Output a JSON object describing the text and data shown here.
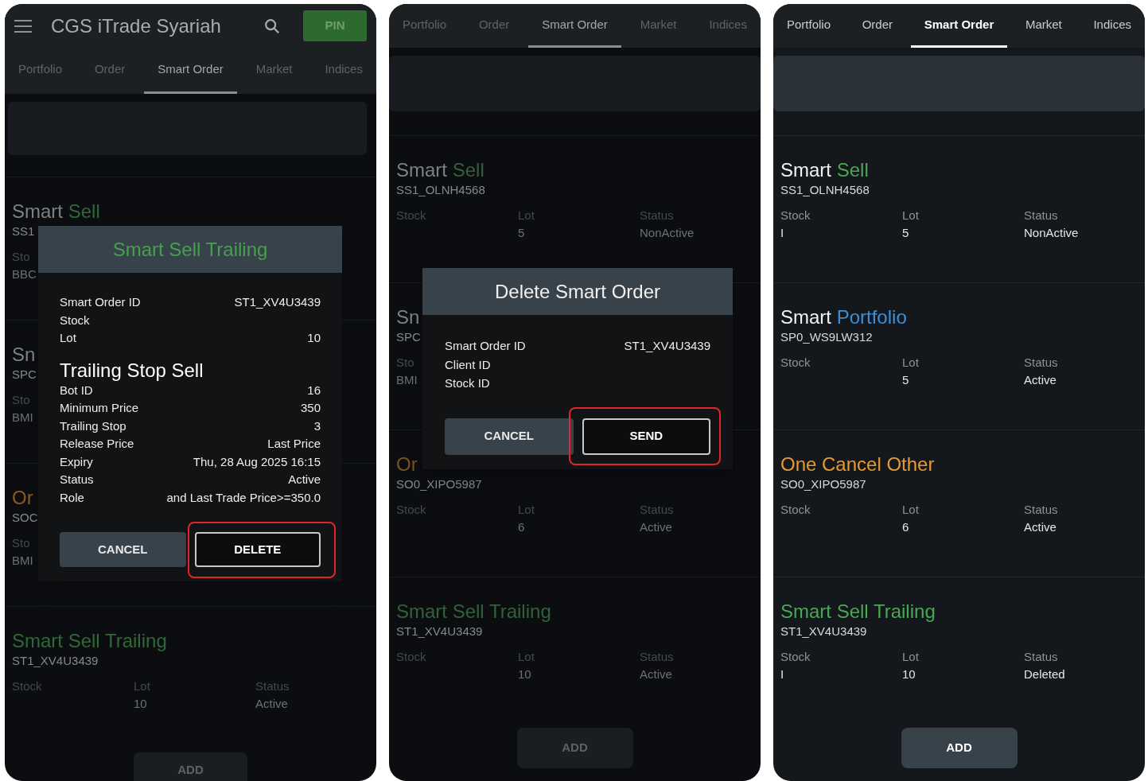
{
  "panels": [
    {
      "dimmed": true,
      "app_bar": {
        "title": "CGS iTrade Syariah",
        "pin_button": "PIN"
      },
      "tabs": [
        {
          "label": "Portfolio",
          "selected": false
        },
        {
          "label": "Order",
          "selected": false
        },
        {
          "label": "Smart Order",
          "selected": true
        },
        {
          "label": "Market",
          "selected": false
        },
        {
          "label": "Indices",
          "selected": false
        }
      ],
      "cards": [
        {
          "prefix": "Smart",
          "name": "Sell",
          "color": "#2f6a35",
          "id": "SS1",
          "fields": [
            {
              "label": "Sto",
              "value": "BBC"
            }
          ]
        },
        {
          "prefix": "Sn",
          "id": "SPC",
          "fields": [
            {
              "label": "Sto",
              "value": "BMI"
            }
          ]
        },
        {
          "name": "Or",
          "color": "#8a5a24",
          "id": "SOC",
          "fields": [
            {
              "label": "Sto",
              "value": "BMI"
            }
          ]
        },
        {
          "name": "Smart Sell Trailing",
          "color": "#2f6a35",
          "id": "ST1_XV4U3439",
          "fields": [
            {
              "label": "Stock"
            },
            {
              "label": "Lot",
              "value": "10"
            },
            {
              "label": "Status",
              "value": "Active"
            }
          ]
        }
      ],
      "add_button": "ADD",
      "dialog": {
        "kind": "detail",
        "title": "Smart Sell Trailing",
        "rows": [
          {
            "label": "Smart Order ID",
            "value": "ST1_XV4U3439"
          },
          {
            "label": "Stock"
          },
          {
            "label": "Lot",
            "value": "10"
          }
        ],
        "section_title": "Trailing Stop Sell",
        "section_rows": [
          {
            "label": "Bot ID",
            "value": "16"
          },
          {
            "label": "Minimum Price",
            "value": "350"
          },
          {
            "label": "Trailing Stop",
            "value": "3"
          },
          {
            "label": "Release Price",
            "value": "Last Price"
          },
          {
            "label": "Expiry",
            "value": "Thu, 28 Aug 2025 16:15"
          },
          {
            "label": "Status",
            "value": "Active"
          },
          {
            "label": "Role",
            "value": "and Last Trade Price>=350.0"
          }
        ],
        "buttons": [
          {
            "label": "CANCEL",
            "kind": "filled",
            "highlighted": false
          },
          {
            "label": "DELETE",
            "kind": "outlined",
            "highlighted": true
          }
        ]
      }
    },
    {
      "dimmed": true,
      "tabs": [
        {
          "label": "Portfolio",
          "selected": false
        },
        {
          "label": "Order",
          "selected": false
        },
        {
          "label": "Smart Order",
          "selected": true
        },
        {
          "label": "Market",
          "selected": false
        },
        {
          "label": "Indices",
          "selected": false
        }
      ],
      "cards": [
        {
          "prefix": "Smart",
          "name": "Sell",
          "color": "#33623a",
          "id": "SS1_OLNH4568",
          "fields": [
            {
              "label": "Stock"
            },
            {
              "label": "Lot",
              "value": "5"
            },
            {
              "label": "Status",
              "value": "NonActive"
            }
          ]
        },
        {
          "prefix": "Sn",
          "id": "SPC",
          "fields": [
            {
              "label": "Sto",
              "value": "BMI"
            }
          ]
        },
        {
          "name": "Or",
          "color": "#7a5222",
          "id": "SO0_XIPO5987",
          "fields": [
            {
              "label": "Stock"
            },
            {
              "label": "Lot",
              "value": "6"
            },
            {
              "label": "Status",
              "value": "Active"
            }
          ]
        },
        {
          "name": "Smart Sell Trailing",
          "color": "#33623a",
          "id": "ST1_XV4U3439",
          "fields": [
            {
              "label": "Stock"
            },
            {
              "label": "Lot",
              "value": "10"
            },
            {
              "label": "Status",
              "value": "Active"
            }
          ]
        }
      ],
      "add_button": "ADD",
      "dialog": {
        "kind": "confirm",
        "title": "Delete Smart Order",
        "rows": [
          {
            "label": "Smart Order ID",
            "value": "ST1_XV4U3439"
          },
          {
            "label": "Client ID"
          },
          {
            "label": "Stock ID"
          }
        ],
        "buttons": [
          {
            "label": "CANCEL",
            "kind": "filled",
            "highlighted": false
          },
          {
            "label": "SEND",
            "kind": "outlined",
            "highlighted": true
          }
        ]
      }
    },
    {
      "dimmed": false,
      "tabs": [
        {
          "label": "Portfolio",
          "selected": false
        },
        {
          "label": "Order",
          "selected": false
        },
        {
          "label": "Smart Order",
          "selected": true
        },
        {
          "label": "Market",
          "selected": false
        },
        {
          "label": "Indices",
          "selected": false
        }
      ],
      "cards": [
        {
          "prefix": "Smart",
          "name": "Sell",
          "color": "#48a853",
          "id": "SS1_OLNH4568",
          "fields": [
            {
              "label": "Stock",
              "value": "I"
            },
            {
              "label": "Lot",
              "value": "5"
            },
            {
              "label": "Status",
              "value": "NonActive"
            }
          ]
        },
        {
          "prefix": "Smart",
          "name": "Portfolio",
          "color": "#3c8fd6",
          "id": "SP0_WS9LW312",
          "fields": [
            {
              "label": "Stock"
            },
            {
              "label": "Lot",
              "value": "5"
            },
            {
              "label": "Status",
              "value": "Active"
            }
          ]
        },
        {
          "name": "One Cancel Other",
          "color": "#e39a34",
          "id": "SO0_XIPO5987",
          "fields": [
            {
              "label": "Stock"
            },
            {
              "label": "Lot",
              "value": "6"
            },
            {
              "label": "Status",
              "value": "Active"
            }
          ]
        },
        {
          "name": "Smart Sell Trailing",
          "color": "#48a853",
          "id": "ST1_XV4U3439",
          "fields": [
            {
              "label": "Stock",
              "value": "I"
            },
            {
              "label": "Lot",
              "value": "10"
            },
            {
              "label": "Status",
              "value": "Deleted"
            }
          ]
        }
      ],
      "add_button": "ADD"
    }
  ]
}
